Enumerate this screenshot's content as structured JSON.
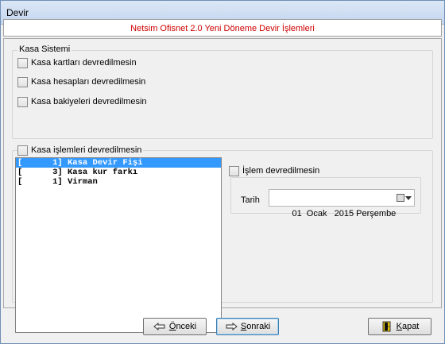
{
  "window": {
    "title": "Devir"
  },
  "header": {
    "text": "Netsim Ofisnet 2.0 Yeni Döneme Devir İşlemleri"
  },
  "kasa_sistemi": {
    "legend": "Kasa Sistemi",
    "options": [
      {
        "label": "Kasa kartları devredilmesin",
        "checked": false
      },
      {
        "label": "Kasa hesapları devredilmesin",
        "checked": false
      },
      {
        "label": "Kasa bakiyeleri devredilmesin",
        "checked": false
      }
    ]
  },
  "kasa_islemleri": {
    "legend": "Kasa işlemleri devredilmesin",
    "checked": false,
    "items": [
      {
        "text": "[      1] Kasa Devir Fişi",
        "selected": true
      },
      {
        "text": "[      3] Kasa kur farkı",
        "selected": false
      },
      {
        "text": "[      1] Virman",
        "selected": false
      }
    ]
  },
  "islem": {
    "label": "İşlem devredilmesin",
    "checked": false,
    "date_label": "Tarih",
    "date_value": "01  Ocak   2015 Perşembe"
  },
  "buttons": {
    "prev": {
      "prefix": "",
      "accel": "Ö",
      "rest": "nceki",
      "icon": "back-hand-icon"
    },
    "next": {
      "prefix": "",
      "accel": "S",
      "rest": "onraki",
      "icon": "forward-hand-icon"
    },
    "close": {
      "prefix": "",
      "accel": "K",
      "rest": "apat",
      "icon": "exit-door-icon"
    }
  },
  "colors": {
    "header_text": "#d00000",
    "selection": "#3399ff"
  }
}
